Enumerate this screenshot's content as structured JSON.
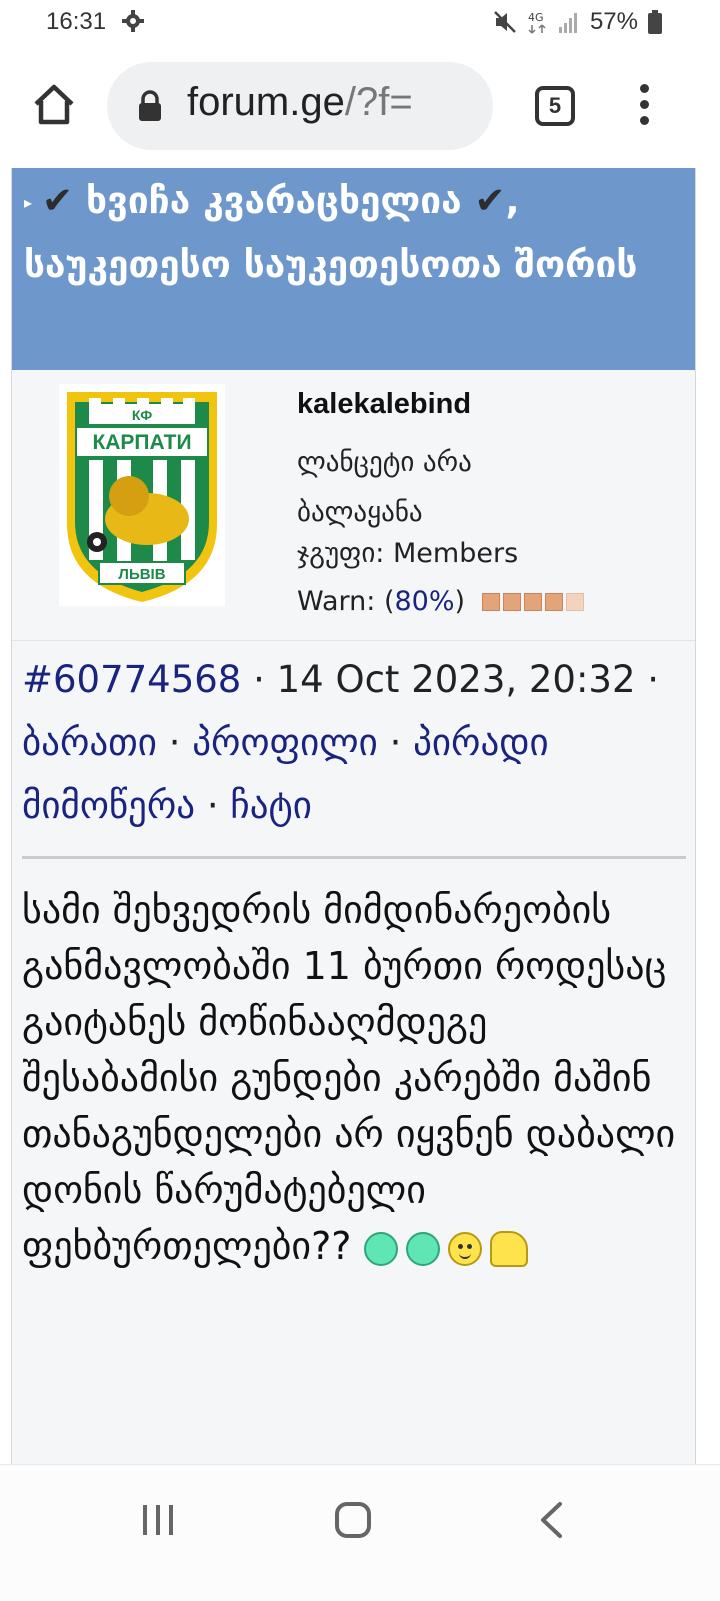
{
  "status_bar": {
    "time": "16:31",
    "network": "4G",
    "battery_percent": "57%"
  },
  "browser": {
    "url_host": "forum.ge",
    "url_path": "/?f=",
    "tab_count": "5"
  },
  "topic": {
    "title_name": "ხვიჩა კვარაცხელია",
    "title_rest": ", საუკეთესო საუკეთესოთა შორის"
  },
  "user": {
    "username": "kalekalebind",
    "title": "ლანცეტი არა ბალაყანა",
    "group_label": "ჯგუფი:",
    "group_value": "Members",
    "warn_label": "Warn:",
    "warn_value": "80%",
    "warn_level": 0.8,
    "avatar_top": "КФ",
    "avatar_name": "КАРПАТИ",
    "avatar_city": "ЛЬВІВ"
  },
  "post": {
    "id": "#60774568",
    "datetime": "14 Oct 2023, 20:32",
    "links": [
      "ბარათი",
      "პროფილი",
      "პირადი მიმოწერა",
      "ჩატი"
    ],
    "body": "სამი შეხვედრის მიმდინარეობის განმავლობაში 11 ბურთი როდესაც გაიტანეს მოწინააღმდეგე შესაბამისი გუნდები კარებში მაშინ თანაგუნდელები არ იყვნენ დაბალი დონის წარუმატებელი ფეხბურთელები??",
    "smileys": [
      "dot-smiley",
      "dot-smiley",
      "smile-smiley",
      "facepalm-smiley"
    ]
  },
  "colors": {
    "header_bg": "#6e98cc",
    "link": "#1a237e",
    "post_bg": "#f4f6f8"
  }
}
